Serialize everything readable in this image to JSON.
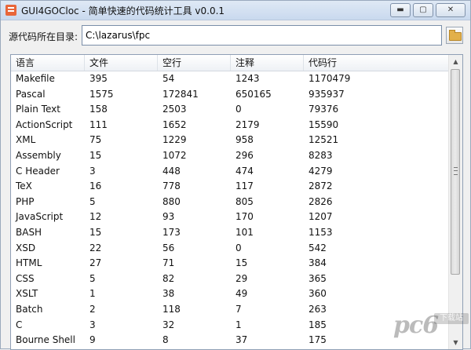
{
  "window": {
    "title": "GUI4GOCloc - 简单快速的代码统计工具 v0.0.1",
    "minimize": "▬",
    "maximize": "▢",
    "close": "✕"
  },
  "directory": {
    "label": "源代码所在目录:",
    "value": "C:\\lazarus\\fpc"
  },
  "table": {
    "columns": [
      "语言",
      "文件",
      "空行",
      "注释",
      "代码行"
    ],
    "rows": [
      [
        "Makefile",
        "395",
        "54",
        "1243",
        "1170479"
      ],
      [
        "Pascal",
        "1575",
        "172841",
        "650165",
        "935937"
      ],
      [
        "Plain Text",
        "158",
        "2503",
        "0",
        "79376"
      ],
      [
        "ActionScript",
        "111",
        "1652",
        "2179",
        "15590"
      ],
      [
        "XML",
        "75",
        "1229",
        "958",
        "12521"
      ],
      [
        "Assembly",
        "15",
        "1072",
        "296",
        "8283"
      ],
      [
        "C Header",
        "3",
        "448",
        "474",
        "4279"
      ],
      [
        "TeX",
        "16",
        "778",
        "117",
        "2872"
      ],
      [
        "PHP",
        "5",
        "880",
        "805",
        "2826"
      ],
      [
        "JavaScript",
        "12",
        "93",
        "170",
        "1207"
      ],
      [
        "BASH",
        "15",
        "173",
        "101",
        "1153"
      ],
      [
        "XSD",
        "22",
        "56",
        "0",
        "542"
      ],
      [
        "HTML",
        "27",
        "71",
        "15",
        "384"
      ],
      [
        "CSS",
        "5",
        "82",
        "29",
        "365"
      ],
      [
        "XSLT",
        "1",
        "38",
        "49",
        "360"
      ],
      [
        "Batch",
        "2",
        "118",
        "7",
        "263"
      ],
      [
        "C",
        "3",
        "32",
        "1",
        "185"
      ],
      [
        "Bourne Shell",
        "9",
        "8",
        "37",
        "175"
      ]
    ]
  },
  "scrollbar": {
    "up_arrow": "▲",
    "down_arrow": "▼",
    "position": 0
  },
  "watermark": {
    "logo": "pc6",
    "badge": "下载站"
  }
}
